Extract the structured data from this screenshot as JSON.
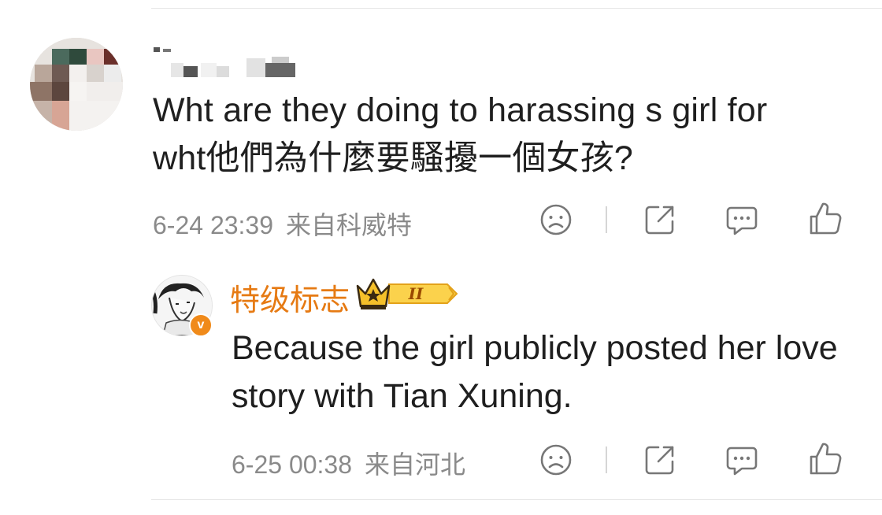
{
  "main_comment": {
    "text": "Wht are they doing to harassing s girl for wht他們為什麼要騷擾一個女孩?",
    "time": "6-24 23:39",
    "source": "来自科威特"
  },
  "reply": {
    "username": "特级标志",
    "level": "II",
    "text": "Because the girl publicly posted her love story with Tian Xuning.",
    "time": "6-25 00:38",
    "source": "来自河北"
  },
  "icons": [
    "dislike-face-icon",
    "share-icon",
    "comment-icon",
    "like-thumb-icon"
  ],
  "colors": {
    "accent_orange": "#e67a13",
    "meta_gray": "#8a8a8a",
    "text": "#1f1f1f"
  }
}
